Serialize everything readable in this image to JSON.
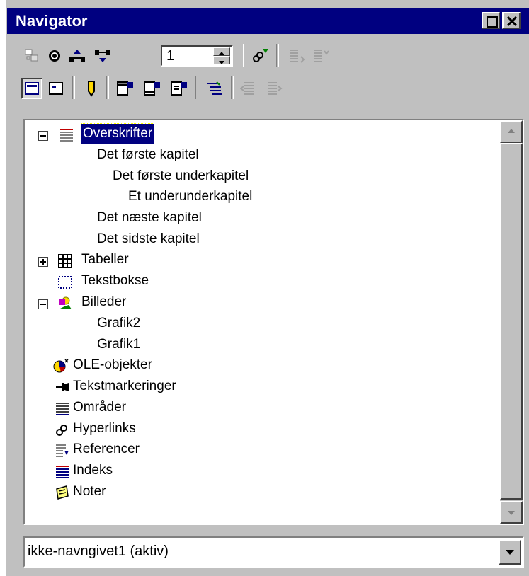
{
  "window": {
    "title": "Navigator"
  },
  "toolbar": {
    "spin_value": "1"
  },
  "tree": {
    "root_selected": "Overskrifter",
    "headings": [
      "Det første kapitel",
      "Det første underkapitel",
      "Et underunderkapitel",
      "Det næste kapitel",
      "Det sidste kapitel"
    ],
    "tables": "Tabeller",
    "textboxes": "Tekstbokse",
    "images": "Billeder",
    "image_items": [
      "Grafik2",
      "Grafik1"
    ],
    "ole": "OLE-objekter",
    "bookmarks": "Tekstmarkeringer",
    "sections": "Områder",
    "hyperlinks": "Hyperlinks",
    "references": "Referencer",
    "indexes": "Indeks",
    "notes": "Noter"
  },
  "document_select": {
    "value": "ikke-navngivet1 (aktiv)"
  },
  "colors": {
    "titlebar": "#000080",
    "face": "#c0c0c0",
    "selection": "#000080"
  }
}
